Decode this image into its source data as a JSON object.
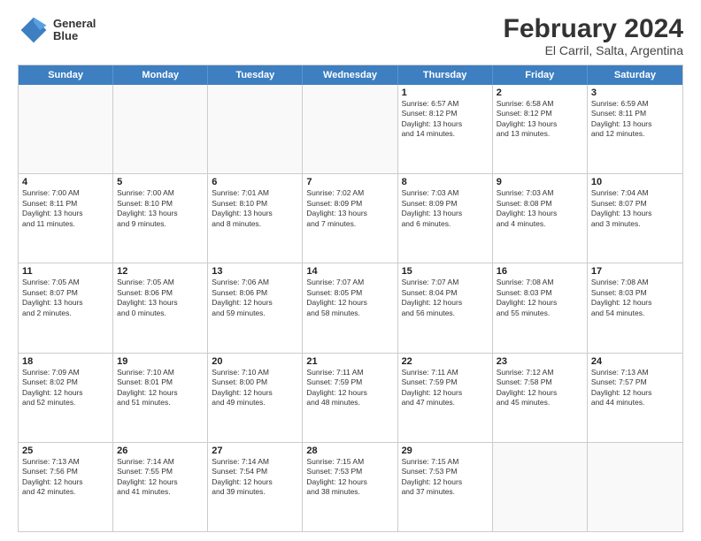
{
  "logo": {
    "line1": "General",
    "line2": "Blue"
  },
  "title": "February 2024",
  "subtitle": "El Carril, Salta, Argentina",
  "headers": [
    "Sunday",
    "Monday",
    "Tuesday",
    "Wednesday",
    "Thursday",
    "Friday",
    "Saturday"
  ],
  "rows": [
    [
      {
        "day": "",
        "info": "",
        "empty": true
      },
      {
        "day": "",
        "info": "",
        "empty": true
      },
      {
        "day": "",
        "info": "",
        "empty": true
      },
      {
        "day": "",
        "info": "",
        "empty": true
      },
      {
        "day": "1",
        "info": "Sunrise: 6:57 AM\nSunset: 8:12 PM\nDaylight: 13 hours\nand 14 minutes."
      },
      {
        "day": "2",
        "info": "Sunrise: 6:58 AM\nSunset: 8:12 PM\nDaylight: 13 hours\nand 13 minutes."
      },
      {
        "day": "3",
        "info": "Sunrise: 6:59 AM\nSunset: 8:11 PM\nDaylight: 13 hours\nand 12 minutes."
      }
    ],
    [
      {
        "day": "4",
        "info": "Sunrise: 7:00 AM\nSunset: 8:11 PM\nDaylight: 13 hours\nand 11 minutes."
      },
      {
        "day": "5",
        "info": "Sunrise: 7:00 AM\nSunset: 8:10 PM\nDaylight: 13 hours\nand 9 minutes."
      },
      {
        "day": "6",
        "info": "Sunrise: 7:01 AM\nSunset: 8:10 PM\nDaylight: 13 hours\nand 8 minutes."
      },
      {
        "day": "7",
        "info": "Sunrise: 7:02 AM\nSunset: 8:09 PM\nDaylight: 13 hours\nand 7 minutes."
      },
      {
        "day": "8",
        "info": "Sunrise: 7:03 AM\nSunset: 8:09 PM\nDaylight: 13 hours\nand 6 minutes."
      },
      {
        "day": "9",
        "info": "Sunrise: 7:03 AM\nSunset: 8:08 PM\nDaylight: 13 hours\nand 4 minutes."
      },
      {
        "day": "10",
        "info": "Sunrise: 7:04 AM\nSunset: 8:07 PM\nDaylight: 13 hours\nand 3 minutes."
      }
    ],
    [
      {
        "day": "11",
        "info": "Sunrise: 7:05 AM\nSunset: 8:07 PM\nDaylight: 13 hours\nand 2 minutes."
      },
      {
        "day": "12",
        "info": "Sunrise: 7:05 AM\nSunset: 8:06 PM\nDaylight: 13 hours\nand 0 minutes."
      },
      {
        "day": "13",
        "info": "Sunrise: 7:06 AM\nSunset: 8:06 PM\nDaylight: 12 hours\nand 59 minutes."
      },
      {
        "day": "14",
        "info": "Sunrise: 7:07 AM\nSunset: 8:05 PM\nDaylight: 12 hours\nand 58 minutes."
      },
      {
        "day": "15",
        "info": "Sunrise: 7:07 AM\nSunset: 8:04 PM\nDaylight: 12 hours\nand 56 minutes."
      },
      {
        "day": "16",
        "info": "Sunrise: 7:08 AM\nSunset: 8:03 PM\nDaylight: 12 hours\nand 55 minutes."
      },
      {
        "day": "17",
        "info": "Sunrise: 7:08 AM\nSunset: 8:03 PM\nDaylight: 12 hours\nand 54 minutes."
      }
    ],
    [
      {
        "day": "18",
        "info": "Sunrise: 7:09 AM\nSunset: 8:02 PM\nDaylight: 12 hours\nand 52 minutes."
      },
      {
        "day": "19",
        "info": "Sunrise: 7:10 AM\nSunset: 8:01 PM\nDaylight: 12 hours\nand 51 minutes."
      },
      {
        "day": "20",
        "info": "Sunrise: 7:10 AM\nSunset: 8:00 PM\nDaylight: 12 hours\nand 49 minutes."
      },
      {
        "day": "21",
        "info": "Sunrise: 7:11 AM\nSunset: 7:59 PM\nDaylight: 12 hours\nand 48 minutes."
      },
      {
        "day": "22",
        "info": "Sunrise: 7:11 AM\nSunset: 7:59 PM\nDaylight: 12 hours\nand 47 minutes."
      },
      {
        "day": "23",
        "info": "Sunrise: 7:12 AM\nSunset: 7:58 PM\nDaylight: 12 hours\nand 45 minutes."
      },
      {
        "day": "24",
        "info": "Sunrise: 7:13 AM\nSunset: 7:57 PM\nDaylight: 12 hours\nand 44 minutes."
      }
    ],
    [
      {
        "day": "25",
        "info": "Sunrise: 7:13 AM\nSunset: 7:56 PM\nDaylight: 12 hours\nand 42 minutes."
      },
      {
        "day": "26",
        "info": "Sunrise: 7:14 AM\nSunset: 7:55 PM\nDaylight: 12 hours\nand 41 minutes."
      },
      {
        "day": "27",
        "info": "Sunrise: 7:14 AM\nSunset: 7:54 PM\nDaylight: 12 hours\nand 39 minutes."
      },
      {
        "day": "28",
        "info": "Sunrise: 7:15 AM\nSunset: 7:53 PM\nDaylight: 12 hours\nand 38 minutes."
      },
      {
        "day": "29",
        "info": "Sunrise: 7:15 AM\nSunset: 7:53 PM\nDaylight: 12 hours\nand 37 minutes."
      },
      {
        "day": "",
        "info": "",
        "empty": true
      },
      {
        "day": "",
        "info": "",
        "empty": true
      }
    ]
  ]
}
